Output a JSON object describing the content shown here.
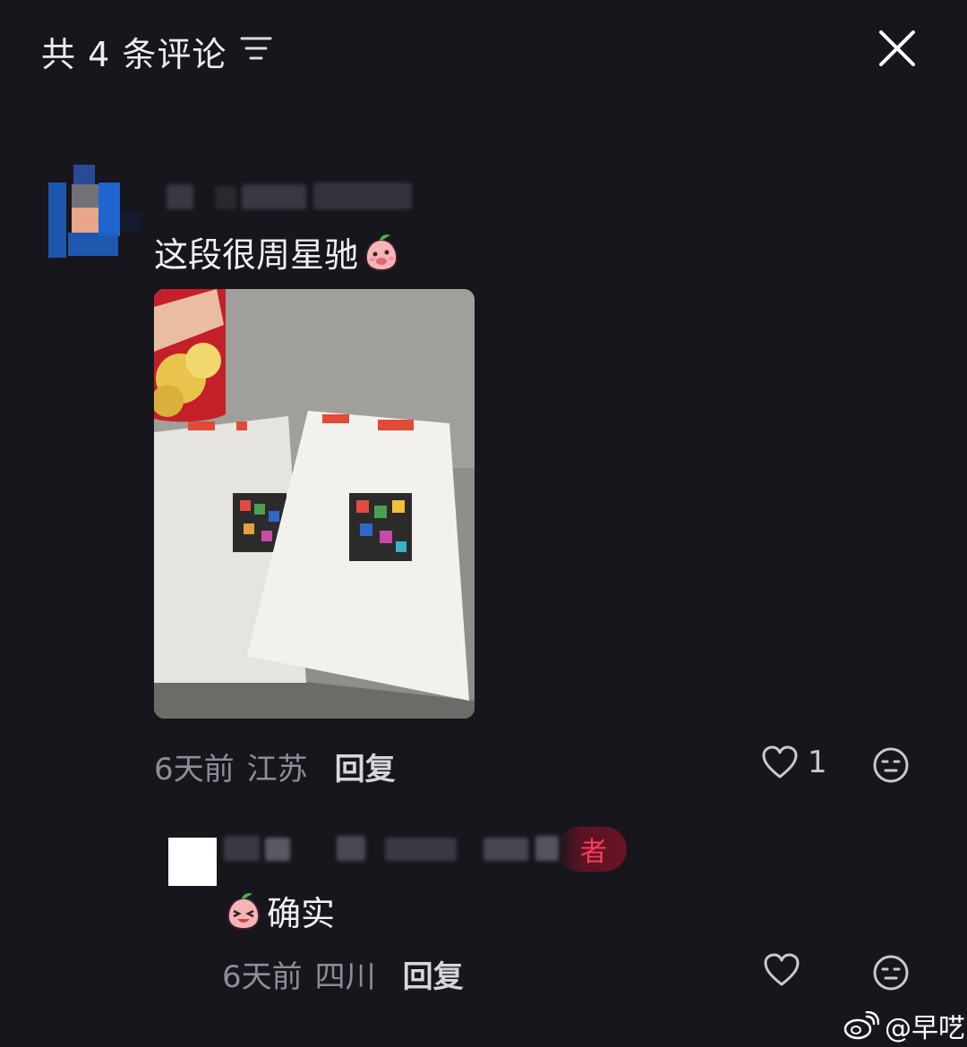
{
  "header": {
    "title": "共 4 条评论"
  },
  "comments": [
    {
      "text": "这段很周星驰",
      "time": "6天前",
      "location": "江苏",
      "reply_label": "回复",
      "like_count": "1"
    }
  ],
  "reply": {
    "author_badge": "者",
    "text": "确实",
    "time": "6天前",
    "location": "四川",
    "reply_label": "回复"
  },
  "watermark": {
    "text": "@早呓"
  },
  "colors": {
    "background": "#17161d",
    "author_badge": "#ff3b5c"
  }
}
